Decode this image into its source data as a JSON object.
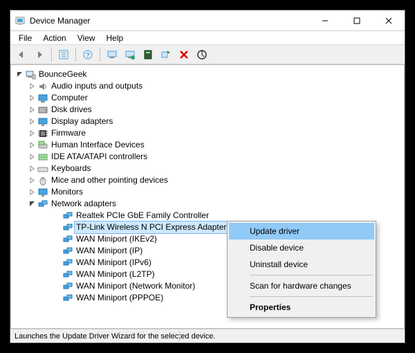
{
  "titlebar": {
    "title": "Device Manager"
  },
  "menubar": {
    "items": [
      "File",
      "Action",
      "View",
      "Help"
    ]
  },
  "toolbar": {
    "buttons": [
      "back",
      "forward",
      "sep",
      "show-hidden",
      "sep",
      "help",
      "sep",
      "update-driver",
      "uninstall",
      "scan-pc",
      "scan-hardware",
      "disable",
      "properties"
    ]
  },
  "tree": {
    "root": {
      "label": "BounceGeek",
      "expanded": true
    },
    "top": [
      {
        "id": "audio",
        "label": "Audio inputs and outputs",
        "expanded": false
      },
      {
        "id": "computer",
        "label": "Computer",
        "expanded": false
      },
      {
        "id": "disk",
        "label": "Disk drives",
        "expanded": false
      },
      {
        "id": "display",
        "label": "Display adapters",
        "expanded": false
      },
      {
        "id": "firmware",
        "label": "Firmware",
        "expanded": false
      },
      {
        "id": "hid",
        "label": "Human Interface Devices",
        "expanded": false
      },
      {
        "id": "ide",
        "label": "IDE ATA/ATAPI controllers",
        "expanded": false
      },
      {
        "id": "keyboard",
        "label": "Keyboards",
        "expanded": false
      },
      {
        "id": "mouse",
        "label": "Mice and other pointing devices",
        "expanded": false
      },
      {
        "id": "monitor",
        "label": "Monitors",
        "expanded": false
      }
    ],
    "network": {
      "label": "Network adapters",
      "expanded": true,
      "children": [
        {
          "label": "Realtek PCIe GbE Family Controller"
        },
        {
          "label": "TP-Link Wireless N PCI Express Adapter",
          "selected": true
        },
        {
          "label": "WAN Miniport (IKEv2)"
        },
        {
          "label": "WAN Miniport (IP)"
        },
        {
          "label": "WAN Miniport (IPv6)"
        },
        {
          "label": "WAN Miniport (L2TP)"
        },
        {
          "label": "WAN Miniport (Network Monitor)"
        },
        {
          "label": "WAN Miniport (PPPOE)"
        }
      ]
    }
  },
  "context_menu": {
    "items": [
      {
        "label": "Update driver",
        "highlight": true
      },
      {
        "label": "Disable device"
      },
      {
        "label": "Uninstall device"
      },
      {
        "sep": true
      },
      {
        "label": "Scan for hardware changes"
      },
      {
        "sep": true
      },
      {
        "label": "Properties",
        "bold": true
      }
    ]
  },
  "statusbar": {
    "text": "Launches the Update Driver Wizard for the selected device."
  }
}
